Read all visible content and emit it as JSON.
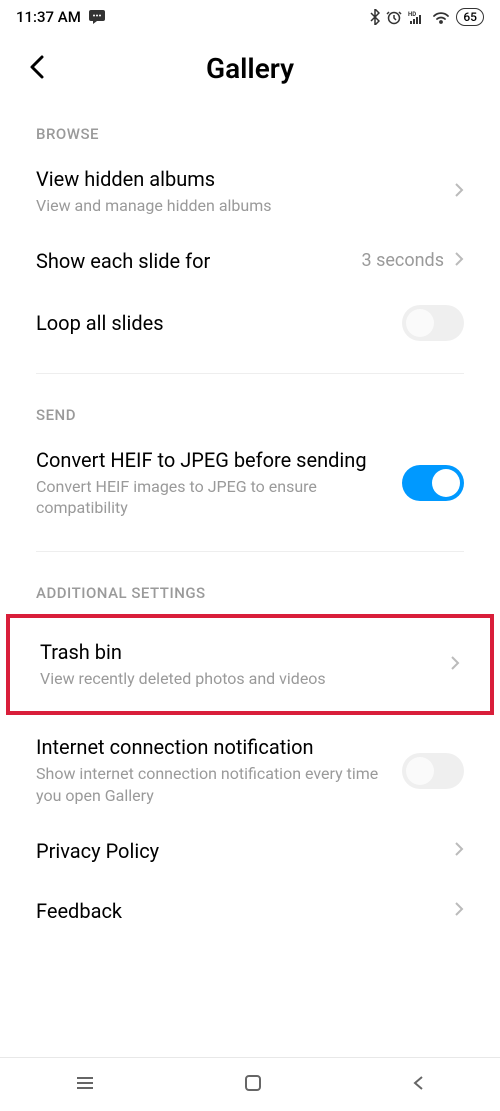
{
  "status_bar": {
    "time": "11:37 AM",
    "battery": "65"
  },
  "header": {
    "title": "Gallery"
  },
  "sections": {
    "browse": {
      "label": "BROWSE",
      "hidden_albums": {
        "title": "View hidden albums",
        "subtitle": "View and manage hidden albums"
      },
      "slide_duration": {
        "title": "Show each slide for",
        "value": "3 seconds"
      },
      "loop": {
        "title": "Loop all slides"
      }
    },
    "send": {
      "label": "SEND",
      "heif": {
        "title": "Convert HEIF to JPEG before sending",
        "subtitle": "Convert HEIF images to JPEG to ensure compatibility"
      }
    },
    "additional": {
      "label": "ADDITIONAL SETTINGS",
      "trash": {
        "title": "Trash bin",
        "subtitle": "View recently deleted photos and videos"
      },
      "internet": {
        "title": "Internet connection notification",
        "subtitle": "Show internet connection notification every time you open Gallery"
      },
      "privacy": {
        "title": "Privacy Policy"
      },
      "feedback": {
        "title": "Feedback"
      }
    }
  }
}
